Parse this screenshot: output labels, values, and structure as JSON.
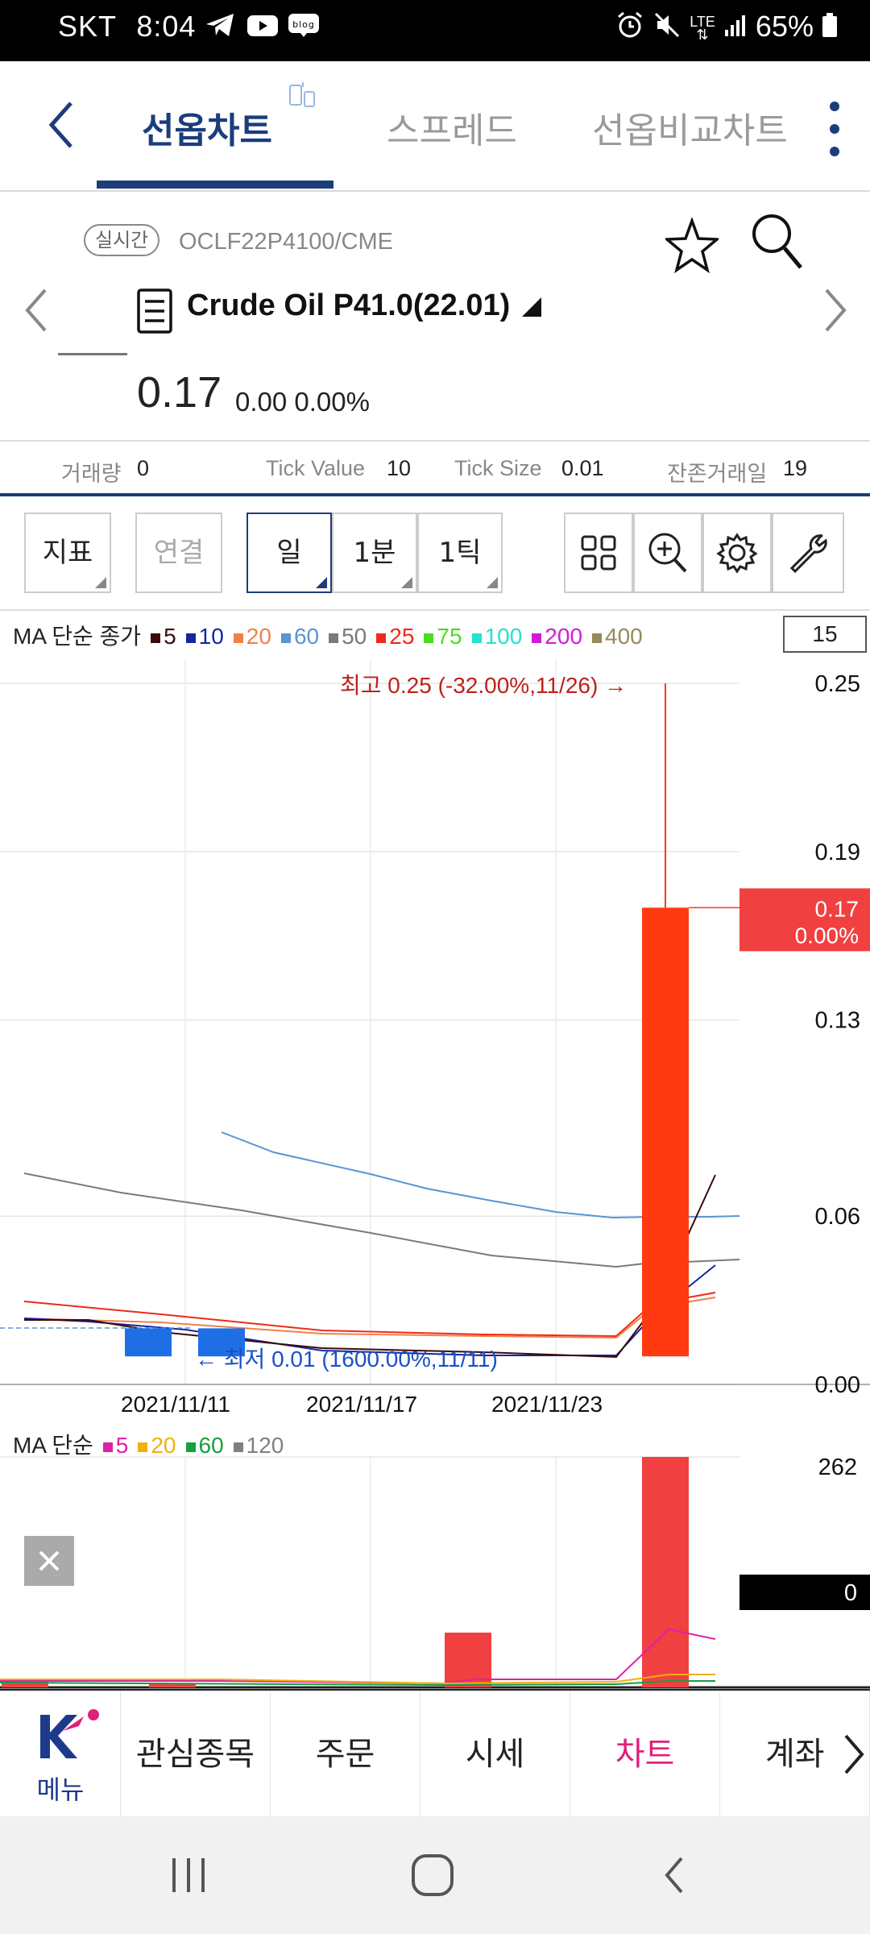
{
  "status_bar": {
    "carrier": "SKT",
    "time": "8:04",
    "battery": "65%",
    "network": "LTE"
  },
  "tabs": [
    {
      "label": "선옵차트",
      "active": true
    },
    {
      "label": "스프레드",
      "active": false
    },
    {
      "label": "선옵비교차트",
      "active": false
    }
  ],
  "instrument": {
    "realtime_badge": "실시간",
    "code": "OCLF22P4100/CME",
    "name": "Crude Oil P41.0(22.01)",
    "price": "0.17",
    "change": "0.00 0.00%"
  },
  "metrics": [
    {
      "label": "거래량",
      "value": "0"
    },
    {
      "label": "Tick Value",
      "value": "10"
    },
    {
      "label": "Tick Size",
      "value": "0.01"
    },
    {
      "label": "잔존거래일",
      "value": "19"
    }
  ],
  "toolbar": {
    "indicator": "지표",
    "link": "연결",
    "day": "일",
    "min": "1분",
    "tick": "1틱"
  },
  "ma_legend": {
    "title": "MA 단순 종가",
    "items": [
      {
        "label": "5",
        "color": "#3b0a0a"
      },
      {
        "label": "10",
        "color": "#1426a0"
      },
      {
        "label": "20",
        "color": "#f2804a"
      },
      {
        "label": "60",
        "color": "#5b94d4"
      },
      {
        "label": "50",
        "color": "#7a7a7a"
      },
      {
        "label": "25",
        "color": "#ee2a1a"
      },
      {
        "label": "75",
        "color": "#4cdc22"
      },
      {
        "label": "100",
        "color": "#22e4cf"
      },
      {
        "label": "200",
        "color": "#d21bd8"
      },
      {
        "label": "400",
        "color": "#968a5a"
      }
    ],
    "count": "15"
  },
  "chart_data": {
    "type": "candlestick",
    "y_ticks": [
      "0.25",
      "0.19",
      "0.13",
      "0.06",
      "0.00"
    ],
    "x_ticks": [
      "2021/11/11",
      "2021/11/17",
      "2021/11/23"
    ],
    "high_annotation": "최고 0.25 (-32.00%,11/26) →",
    "low_annotation": "← 최저 0.01 (1600.00%,11/11)",
    "current_tag": {
      "price": "0.17",
      "pct": "0.00%"
    },
    "candles": [
      {
        "open": 0.02,
        "close": 0.01,
        "color": "#1e6fe6"
      },
      {
        "open": 0.02,
        "close": 0.01,
        "color": "#1e6fe6"
      },
      {
        "open": 0.01,
        "close": 0.17,
        "high": 0.25,
        "color": "#ff3a10"
      }
    ]
  },
  "volume_legend": {
    "title": "MA 단순",
    "items": [
      {
        "label": "5",
        "color": "#e020a8"
      },
      {
        "label": "20",
        "color": "#f0b010"
      },
      {
        "label": "60",
        "color": "#14a040"
      },
      {
        "label": "120",
        "color": "#808080"
      }
    ]
  },
  "volume_chart": {
    "max_label": "262",
    "current_tag": "0"
  },
  "bottom_nav": {
    "menu_label": "메뉴",
    "items": [
      "관심종목",
      "주문",
      "시세",
      "차트",
      "계좌"
    ],
    "active_index": 3
  }
}
